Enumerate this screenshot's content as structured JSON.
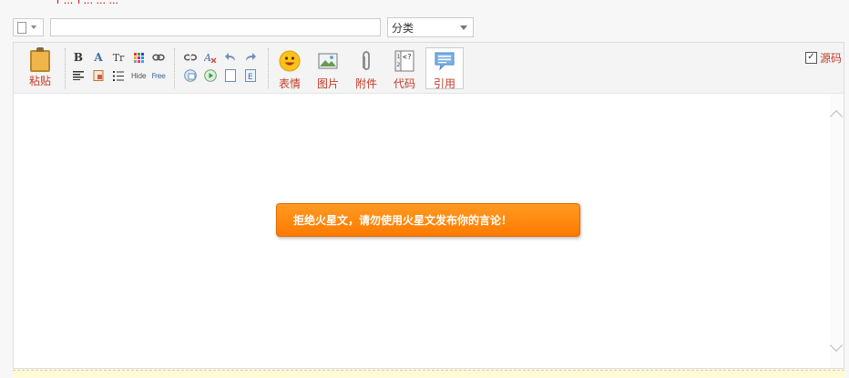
{
  "header": {
    "top_clip_text": "[ ... ] ... ... ..."
  },
  "form": {
    "title_placeholder": "",
    "category": {
      "selected": "分类"
    }
  },
  "toolbar": {
    "paste_label": "粘贴",
    "bold_label": "B",
    "font_face_label": "Tr",
    "hide_label": "Hide",
    "free_label": "Free",
    "emoji_label": "表情",
    "image_label": "图片",
    "attachment_label": "附件",
    "code_label": "代码",
    "quote_label": "引用",
    "source_label": "源码",
    "source_checked": "✓"
  },
  "editor": {
    "warning_text": "拒绝火星文，请勿使用火星文发布你的言论！"
  },
  "colors": {
    "label_red": "#c33b27",
    "warning_orange": "#ff8a10"
  }
}
